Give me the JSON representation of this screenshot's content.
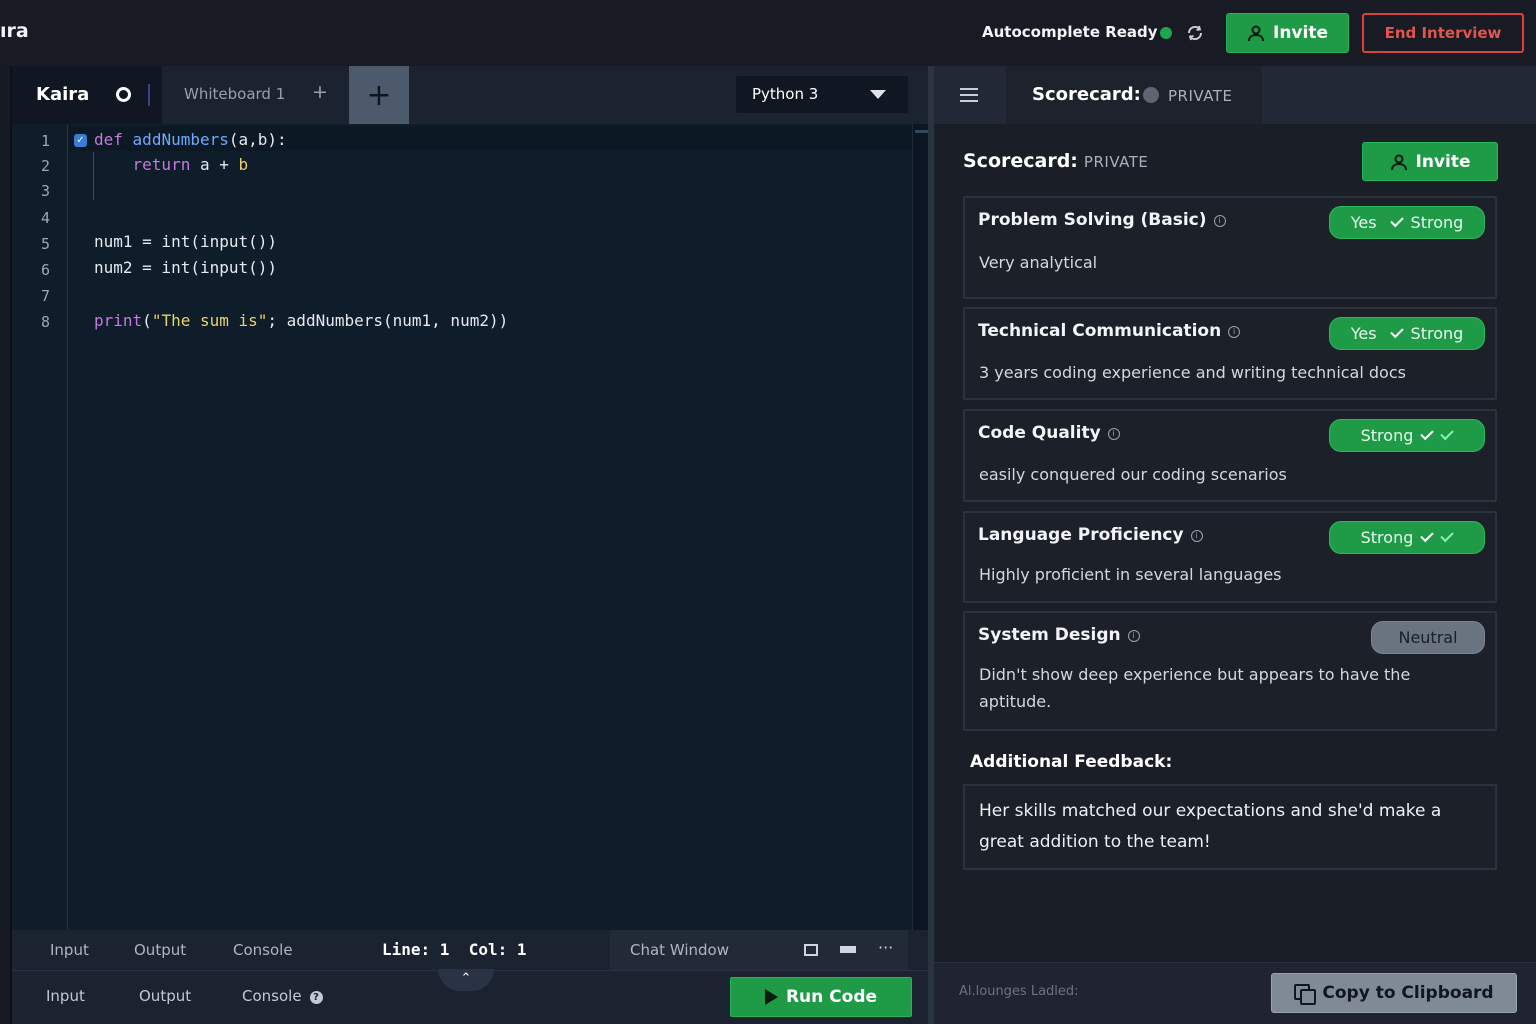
{
  "header": {
    "app_title": "ıra",
    "autocomplete_status": "Autocomplete Ready",
    "invite_label": "Invite",
    "end_interview_label": "End Interview"
  },
  "editor": {
    "tabs": [
      {
        "label": "Kaira"
      },
      {
        "label": "Whiteboard 1",
        "add_symbol": "+"
      }
    ],
    "new_tab_symbol": "+",
    "language": "Python 3",
    "line_numbers": [
      "1",
      "2",
      "3",
      "4",
      "5",
      "6",
      "7",
      "8"
    ],
    "code": {
      "l1_def": "def",
      "l1_fn": "addNumbers",
      "l1_rest": "(a,b):",
      "l2_return": "return",
      "l2_rest": " a + ",
      "l2_b": "b",
      "l5": "num1 = int(input())",
      "l6": "num2 = int(input())",
      "l8_print": "print",
      "l8_open": "(",
      "l8_str": "\"The sum is\"",
      "l8_rest": "; addNumbers(num1, num2))"
    },
    "statusbar": {
      "tabs": [
        "Input",
        "Output",
        "Console"
      ],
      "line_col": "Line: 1  Col: 1",
      "chat_window": "Chat Window"
    },
    "footer": {
      "tabs": [
        "Input",
        "Output",
        "Console"
      ],
      "console_help_icon": "?",
      "run_label": "Run Code"
    }
  },
  "scorecard": {
    "tab_title": "Scorecard:",
    "tab_visibility": "PRIVATE",
    "heading": "Scorecard:",
    "heading_visibility": "PRIVATE",
    "invite_label": "Invite",
    "cards": [
      {
        "title": "Problem Solving (Basic)",
        "rating_yes": "Yes",
        "rating": "Strong",
        "comment": "Very analytical"
      },
      {
        "title": "Technical Communication",
        "rating_yes": "Yes",
        "rating": "Strong",
        "comment": "3 years coding experience and writing technical docs"
      },
      {
        "title": "Code Quality",
        "rating": "Strong",
        "comment": "easily conquered our coding scenarios"
      },
      {
        "title": "Language Proficiency",
        "rating": "Strong",
        "comment": "Highly proficient in several languages"
      },
      {
        "title": "System Design",
        "rating": "Neutral",
        "comment": "Didn't show deep experience but appears to have the aptitude."
      }
    ],
    "additional_label": "Additional Feedback:",
    "additional_text": "Her skills matched our expectations and she'd make a great addition to the team!",
    "footer_status": "Al.lounges Ladled:",
    "copy_label": "Copy to Clipboard"
  },
  "colors": {
    "accent_green": "#1f9b48",
    "danger_red": "#d9413a",
    "neutral_grey": "#6a7380",
    "editor_bg": "#0f1d2b"
  },
  "icons": [
    "sync-icon",
    "user-icon",
    "plus-icon",
    "chevron-down-icon",
    "checkbox-icon",
    "window-maximize-icon",
    "window-minimize-icon",
    "more-icon",
    "help-icon",
    "chevron-up-icon",
    "play-icon",
    "menu-icon",
    "info-icon",
    "check-icon",
    "copy-icon"
  ]
}
